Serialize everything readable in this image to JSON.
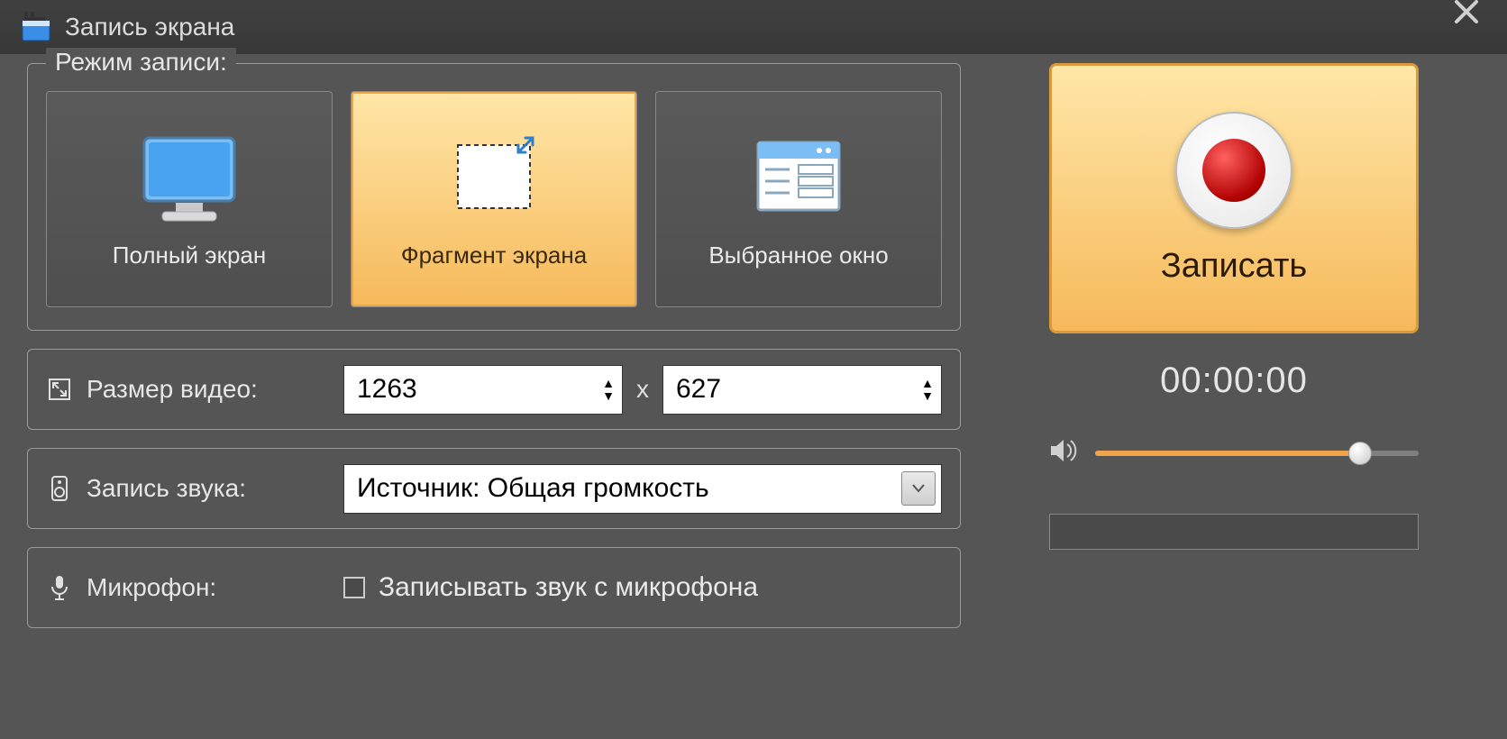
{
  "window": {
    "title": "Запись экрана"
  },
  "mode_group": {
    "legend": "Режим записи:",
    "fullscreen": "Полный экран",
    "fragment": "Фрагмент экрана",
    "window": "Выбранное окно"
  },
  "size": {
    "label": "Размер видео:",
    "width": "1263",
    "height": "627",
    "sep": "x"
  },
  "audio": {
    "label": "Запись звука:",
    "source": "Источник: Общая громкость"
  },
  "mic": {
    "label": "Микрофон:",
    "checkbox_label": "Записывать звук с микрофона"
  },
  "record": {
    "label": "Записать",
    "timer": "00:00:00"
  },
  "volume_percent": 82
}
